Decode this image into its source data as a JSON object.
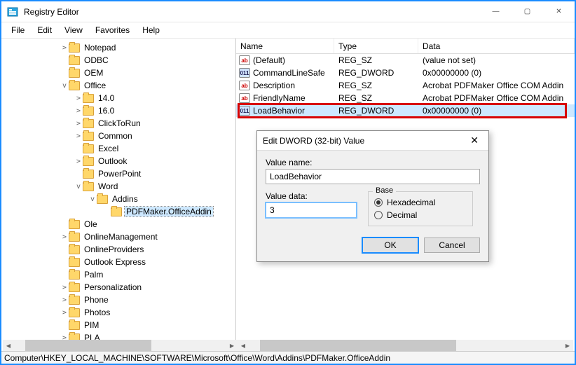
{
  "window": {
    "title": "Registry Editor",
    "minimize": "—",
    "maximize": "▢",
    "close": "✕"
  },
  "menu": {
    "file": "File",
    "edit": "Edit",
    "view": "View",
    "favorites": "Favorites",
    "help": "Help"
  },
  "tree": {
    "notepad": "Notepad",
    "odbc": "ODBC",
    "oem": "OEM",
    "office": "Office",
    "v14": "14.0",
    "v16": "16.0",
    "clicktorun": "ClickToRun",
    "common": "Common",
    "excel": "Excel",
    "outlook": "Outlook",
    "powerpoint": "PowerPoint",
    "word": "Word",
    "addins": "Addins",
    "pdfmaker": "PDFMaker.OfficeAddin",
    "ole": "Ole",
    "onlinemgmt": "OnlineManagement",
    "onlineprov": "OnlineProviders",
    "outlookexp": "Outlook Express",
    "palm": "Palm",
    "personalization": "Personalization",
    "phone": "Phone",
    "photos": "Photos",
    "pim": "PIM",
    "pla": "PLA"
  },
  "list": {
    "headers": {
      "name": "Name",
      "type": "Type",
      "data": "Data"
    },
    "rows": [
      {
        "icon": "sz",
        "name": "(Default)",
        "type": "REG_SZ",
        "data": "(value not set)"
      },
      {
        "icon": "dw",
        "name": "CommandLineSafe",
        "type": "REG_DWORD",
        "data": "0x00000000 (0)"
      },
      {
        "icon": "sz",
        "name": "Description",
        "type": "REG_SZ",
        "data": "Acrobat PDFMaker Office COM Addin"
      },
      {
        "icon": "sz",
        "name": "FriendlyName",
        "type": "REG_SZ",
        "data": "Acrobat PDFMaker Office COM Addin"
      },
      {
        "icon": "dw",
        "name": "LoadBehavior",
        "type": "REG_DWORD",
        "data": "0x00000000 (0)"
      }
    ]
  },
  "dialog": {
    "title": "Edit DWORD (32-bit) Value",
    "valuename_label": "Value name:",
    "valuename": "LoadBehavior",
    "valuedata_label": "Value data:",
    "valuedata": "3",
    "base_label": "Base",
    "hex": "Hexadecimal",
    "dec": "Decimal",
    "ok": "OK",
    "cancel": "Cancel",
    "close": "✕"
  },
  "statusbar": "Computer\\HKEY_LOCAL_MACHINE\\SOFTWARE\\Microsoft\\Office\\Word\\Addins\\PDFMaker.OfficeAddin"
}
